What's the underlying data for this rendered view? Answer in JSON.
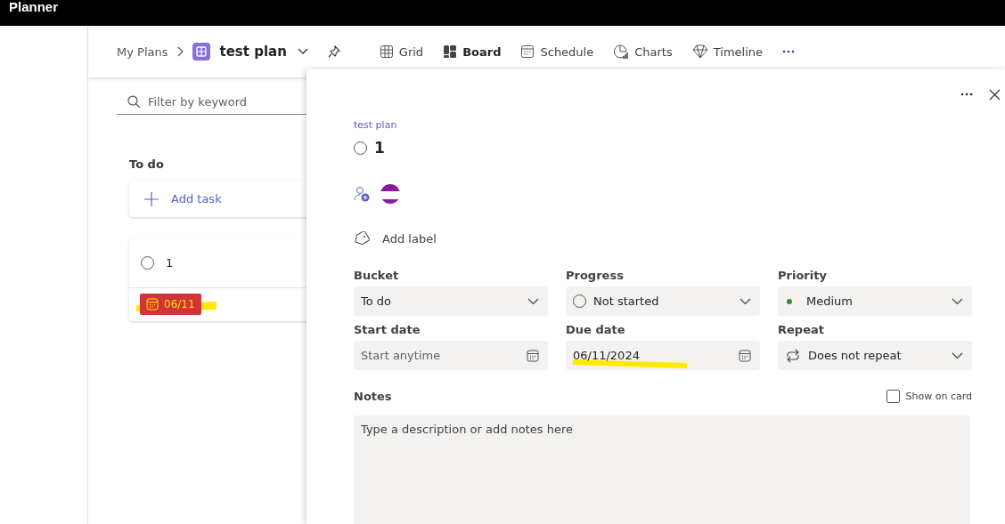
{
  "app": {
    "title": "Planner"
  },
  "breadcrumb": {
    "root": "My Plans",
    "plan": "test plan"
  },
  "views": [
    {
      "label": "Grid",
      "kind": "grid",
      "selected": false
    },
    {
      "label": "Board",
      "kind": "board",
      "selected": true
    },
    {
      "label": "Schedule",
      "kind": "schedule",
      "selected": false
    },
    {
      "label": "Charts",
      "kind": "charts",
      "selected": false
    },
    {
      "label": "Timeline",
      "kind": "timeline",
      "selected": false
    }
  ],
  "filter": {
    "placeholder": "Filter by keyword"
  },
  "bucket": {
    "name": "To do",
    "add_task": "Add task",
    "tasks": [
      {
        "title": "1",
        "completed": false,
        "due": "06/11",
        "overdue": true
      }
    ]
  },
  "task_panel": {
    "plan": "test plan",
    "title": "1",
    "completed": false,
    "add_label": "Add label",
    "fields": [
      {
        "label": "Bucket",
        "kind": "select",
        "value": "To do"
      },
      {
        "label": "Progress",
        "kind": "progress",
        "value": "Not started"
      },
      {
        "label": "Priority",
        "kind": "priority",
        "value": "Medium"
      },
      {
        "label": "Start date",
        "kind": "date",
        "placeholder": "Start anytime"
      },
      {
        "label": "Due date",
        "kind": "date",
        "value": "06/11/2024"
      },
      {
        "label": "Repeat",
        "kind": "repeat",
        "value": "Does not repeat"
      }
    ],
    "notes": {
      "label": "Notes",
      "placeholder": "Type a description or add notes here"
    },
    "show_on_card": {
      "label": "Show on card",
      "checked": false
    }
  }
}
